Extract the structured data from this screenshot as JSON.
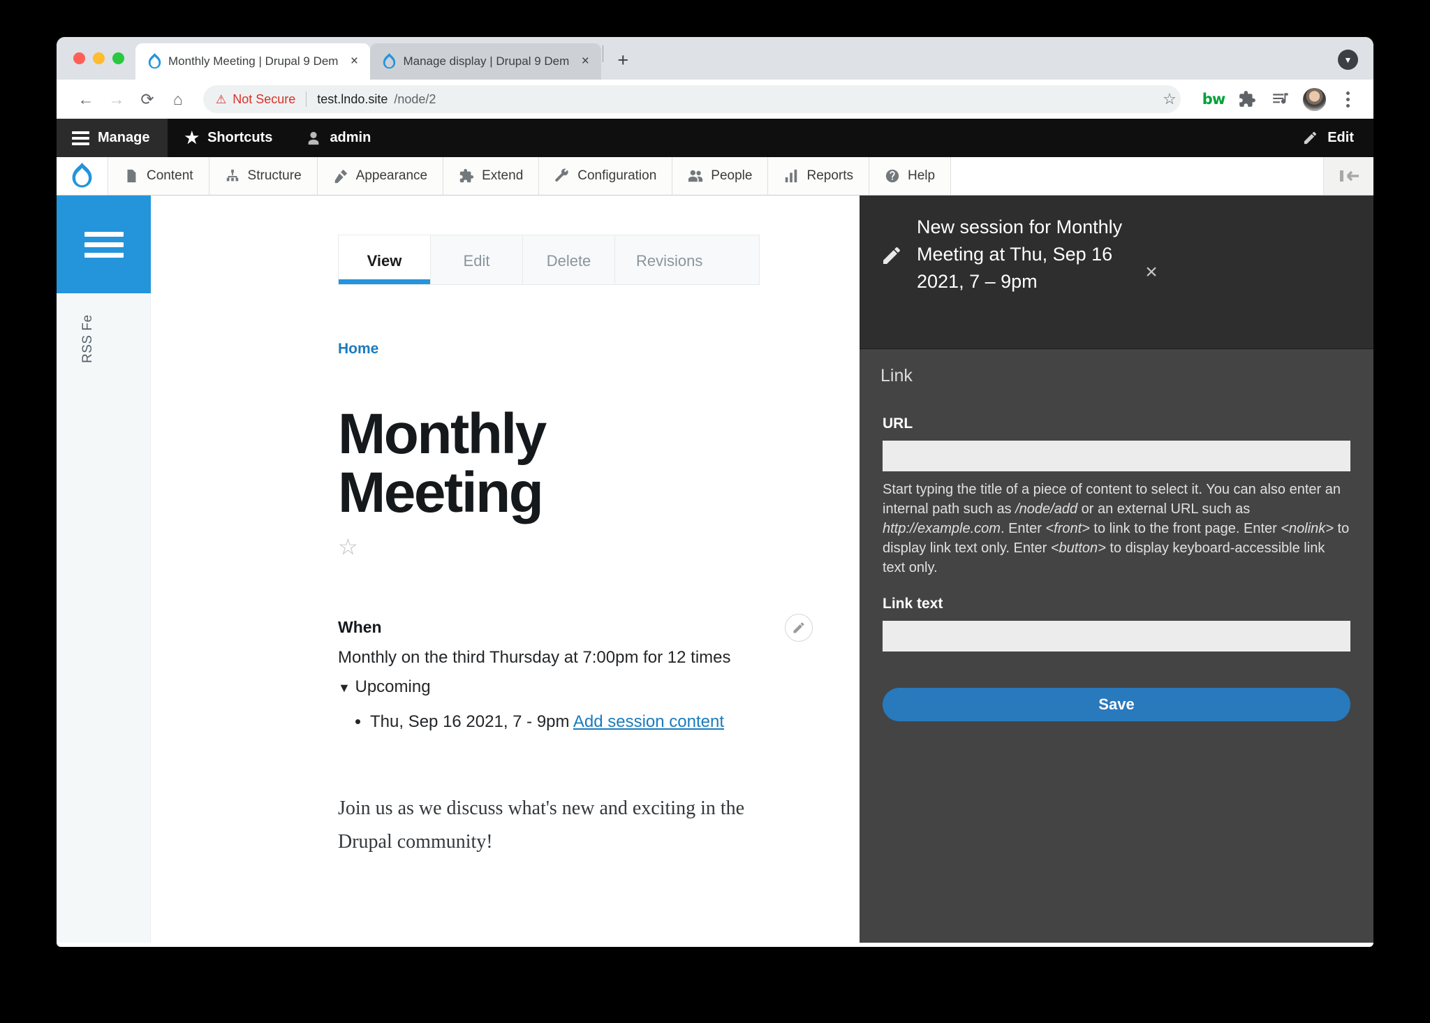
{
  "browser": {
    "tabs": [
      {
        "title": "Monthly Meeting | Drupal 9 Dem",
        "active": true,
        "close_label": "×"
      },
      {
        "title": "Manage display | Drupal 9 Dem",
        "active": false,
        "close_label": "×"
      }
    ],
    "new_tab_label": "+",
    "tab_search_label": "▼",
    "back_label": "←",
    "forward_label": "→",
    "reload_label": "⟳",
    "home_label": "⌂",
    "security_warning": "Not Secure",
    "url_host": "test.lndo.site",
    "url_path": "/node/2",
    "star_label": "☆",
    "extension_bw_label": "bw",
    "kebab_label": "⋮"
  },
  "admin_toolbar": {
    "manage_label": "Manage",
    "shortcuts_label": "Shortcuts",
    "shortcuts_icon": "★",
    "account_label": "admin",
    "edit_label": "Edit"
  },
  "admin_menu": {
    "items": [
      {
        "label": "Content",
        "icon": "content-icon"
      },
      {
        "label": "Structure",
        "icon": "structure-icon"
      },
      {
        "label": "Appearance",
        "icon": "appearance-icon"
      },
      {
        "label": "Extend",
        "icon": "extend-icon"
      },
      {
        "label": "Configuration",
        "icon": "configuration-icon"
      },
      {
        "label": "People",
        "icon": "people-icon"
      },
      {
        "label": "Reports",
        "icon": "reports-icon"
      },
      {
        "label": "Help",
        "icon": "help-icon"
      }
    ]
  },
  "left_rail": {
    "vertical_label": "RSS Fe"
  },
  "local_tasks": [
    {
      "label": "View",
      "active": true
    },
    {
      "label": "Edit",
      "active": false
    },
    {
      "label": "Delete",
      "active": false
    },
    {
      "label": "Revisions",
      "active": false
    }
  ],
  "node": {
    "breadcrumb": "Home",
    "title": "Monthly Meeting",
    "flag_star": "☆",
    "when_label": "When",
    "when_text": "Monthly on the third Thursday at 7:00pm for 12 times",
    "upcoming_caret": "▼",
    "upcoming_label": "Upcoming",
    "sessions": [
      {
        "date": "Thu, Sep 16 2021, 7 - 9pm",
        "link_label": "Add session content"
      }
    ],
    "body": "Join us as we discuss what's new and exciting in the Drupal community!"
  },
  "offcanvas": {
    "title": "New session for Monthly Meeting at Thu, Sep 16 2021, 7 – 9pm",
    "close_label": "×",
    "section_title": "Link",
    "url_field": {
      "label": "URL",
      "value": "",
      "placeholder": ""
    },
    "url_description_parts": [
      {
        "text": "Start typing the title of a piece of content to select it. You can also enter an internal path such as ",
        "italic": false
      },
      {
        "text": "/node/add",
        "italic": true
      },
      {
        "text": " or an external URL such as ",
        "italic": false
      },
      {
        "text": "http://example.com",
        "italic": true
      },
      {
        "text": ". Enter ",
        "italic": false
      },
      {
        "text": "<front>",
        "italic": true
      },
      {
        "text": " to link to the front page. Enter ",
        "italic": false
      },
      {
        "text": "<nolink>",
        "italic": true
      },
      {
        "text": " to display link text only. Enter ",
        "italic": false
      },
      {
        "text": "<button>",
        "italic": true
      },
      {
        "text": " to display keyboard-accessible link text only.",
        "italic": false
      }
    ],
    "link_text_field": {
      "label": "Link text",
      "value": "",
      "placeholder": ""
    },
    "save_label": "Save"
  },
  "colors": {
    "drupal_blue": "#2494db",
    "accent_link": "#1b7bbd",
    "offcanvas_bg": "#444444",
    "offcanvas_header_bg": "#2e2e2e",
    "toolbar_bg": "#0f0f0f",
    "not_secure": "#d93025",
    "save_button": "#2979bd"
  }
}
